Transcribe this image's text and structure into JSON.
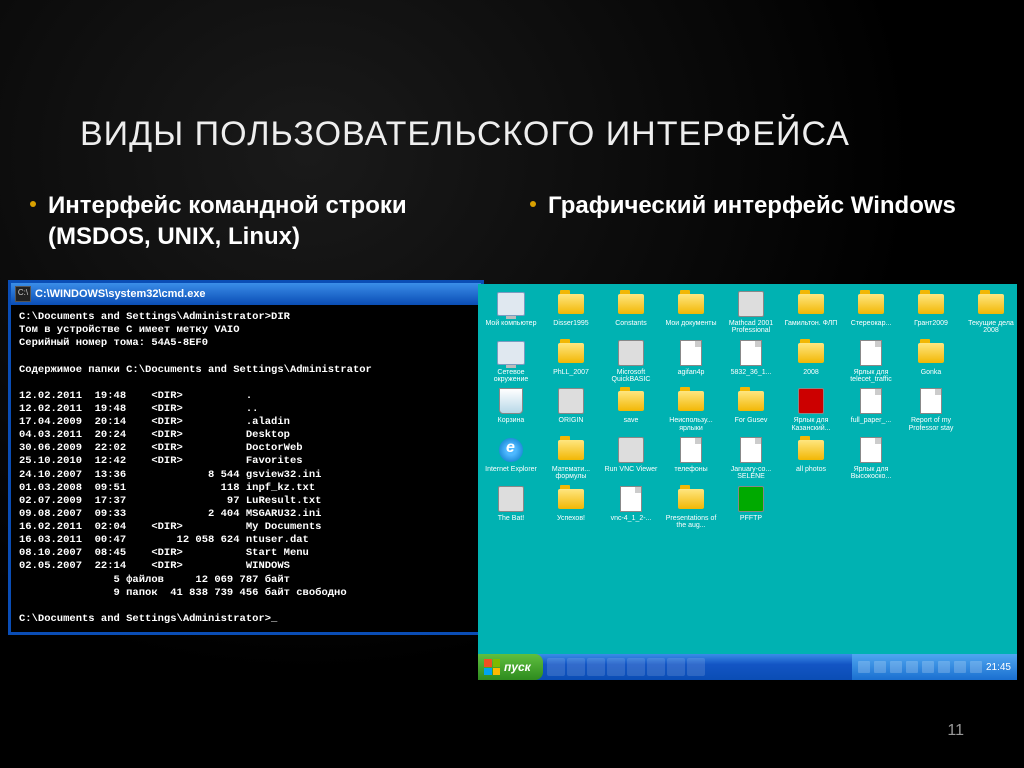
{
  "slide": {
    "title": "ВИДЫ ПОЛЬЗОВАТЕЛЬСКОГО ИНТЕРФЕЙСА",
    "left_bullet": "Интерфейс командной строки (MSDOS, UNIX, Linux)",
    "right_bullet": "Графический интерфейс Windows",
    "page_number": "11"
  },
  "cmd": {
    "title": "C:\\WINDOWS\\system32\\cmd.exe",
    "icon_label": "C:\\",
    "body": "C:\\Documents and Settings\\Administrator>DIR\nТом в устройстве C имеет метку VAIO\nСерийный номер тома: 54A5-8EF0\n\nСодержимое папки C:\\Documents and Settings\\Administrator\n\n12.02.2011  19:48    <DIR>          .\n12.02.2011  19:48    <DIR>          ..\n17.04.2009  20:14    <DIR>          .aladin\n04.03.2011  20:24    <DIR>          Desktop\n30.06.2009  22:02    <DIR>          DoctorWeb\n25.10.2010  12:42    <DIR>          Favorites\n24.10.2007  13:36             8 544 gsview32.ini\n01.03.2008  09:51               118 inpf_kz.txt\n02.07.2009  17:37                97 LuResult.txt\n09.08.2007  09:33             2 404 MSGARU32.ini\n16.02.2011  02:04    <DIR>          My Documents\n16.03.2011  00:47        12 058 624 ntuser.dat\n08.10.2007  08:45    <DIR>          Start Menu\n02.05.2007  22:14    <DIR>          WINDOWS\n               5 файлов     12 069 787 байт\n               9 папок  41 838 739 456 байт свободно\n\nC:\\Documents and Settings\\Administrator>_"
  },
  "desktop": {
    "icons": [
      {
        "label": "Мой компьютер",
        "t": "mycomp"
      },
      {
        "label": "Disser1995",
        "t": "folder"
      },
      {
        "label": "Constants",
        "t": "folder"
      },
      {
        "label": "Мои документы",
        "t": "folder"
      },
      {
        "label": "Mathcad 2001 Professional",
        "t": "exe"
      },
      {
        "label": "Гамильтон. ФЛП",
        "t": "folder"
      },
      {
        "label": "Стереокар...",
        "t": "folder"
      },
      {
        "label": "Грант2009",
        "t": "folder"
      },
      {
        "label": "Текущие дела 2008",
        "t": "folder"
      },
      {
        "label": "Сетевое окружение",
        "t": "mycomp"
      },
      {
        "label": "PhLL_2007",
        "t": "folder"
      },
      {
        "label": "Microsoft QuickBASIC",
        "t": "exe"
      },
      {
        "label": "agifan4p",
        "t": "file"
      },
      {
        "label": "5832_36_1...",
        "t": "file"
      },
      {
        "label": "2008",
        "t": "folder"
      },
      {
        "label": "Ярлык для telecet_traffic",
        "t": "file"
      },
      {
        "label": "Gonka",
        "t": "folder"
      },
      {
        "label": "",
        "t": "empty"
      },
      {
        "label": "Корзина",
        "t": "recycle"
      },
      {
        "label": "ORIGIN",
        "t": "exe"
      },
      {
        "label": "save",
        "t": "folder"
      },
      {
        "label": "Неиспользу... ярлыки",
        "t": "folder"
      },
      {
        "label": "For Gusev",
        "t": "folder"
      },
      {
        "label": "Ярлык для Казанский...",
        "t": "exe red"
      },
      {
        "label": "full_paper_...",
        "t": "file"
      },
      {
        "label": "Report of my Professor stay",
        "t": "file"
      },
      {
        "label": "",
        "t": "empty"
      },
      {
        "label": "Internet Explorer",
        "t": "ie"
      },
      {
        "label": "Математи... формулы",
        "t": "folder"
      },
      {
        "label": "Run VNC Viewer",
        "t": "exe"
      },
      {
        "label": "телефоны",
        "t": "file"
      },
      {
        "label": "January-co... SELENE",
        "t": "file"
      },
      {
        "label": "all photos",
        "t": "folder"
      },
      {
        "label": "Ярлык для Высокоско...",
        "t": "file"
      },
      {
        "label": "",
        "t": "empty"
      },
      {
        "label": "",
        "t": "empty"
      },
      {
        "label": "The Bat!",
        "t": "exe"
      },
      {
        "label": "Успехов!",
        "t": "folder"
      },
      {
        "label": "vnc-4_1_2-...",
        "t": "file"
      },
      {
        "label": "Presentations of the aug...",
        "t": "folder"
      },
      {
        "label": "PFFTP",
        "t": "exe green"
      },
      {
        "label": "",
        "t": "empty"
      },
      {
        "label": "",
        "t": "empty"
      },
      {
        "label": "",
        "t": "empty"
      },
      {
        "label": "",
        "t": "empty"
      }
    ],
    "start_label": "пуск",
    "clock": "21:45"
  }
}
